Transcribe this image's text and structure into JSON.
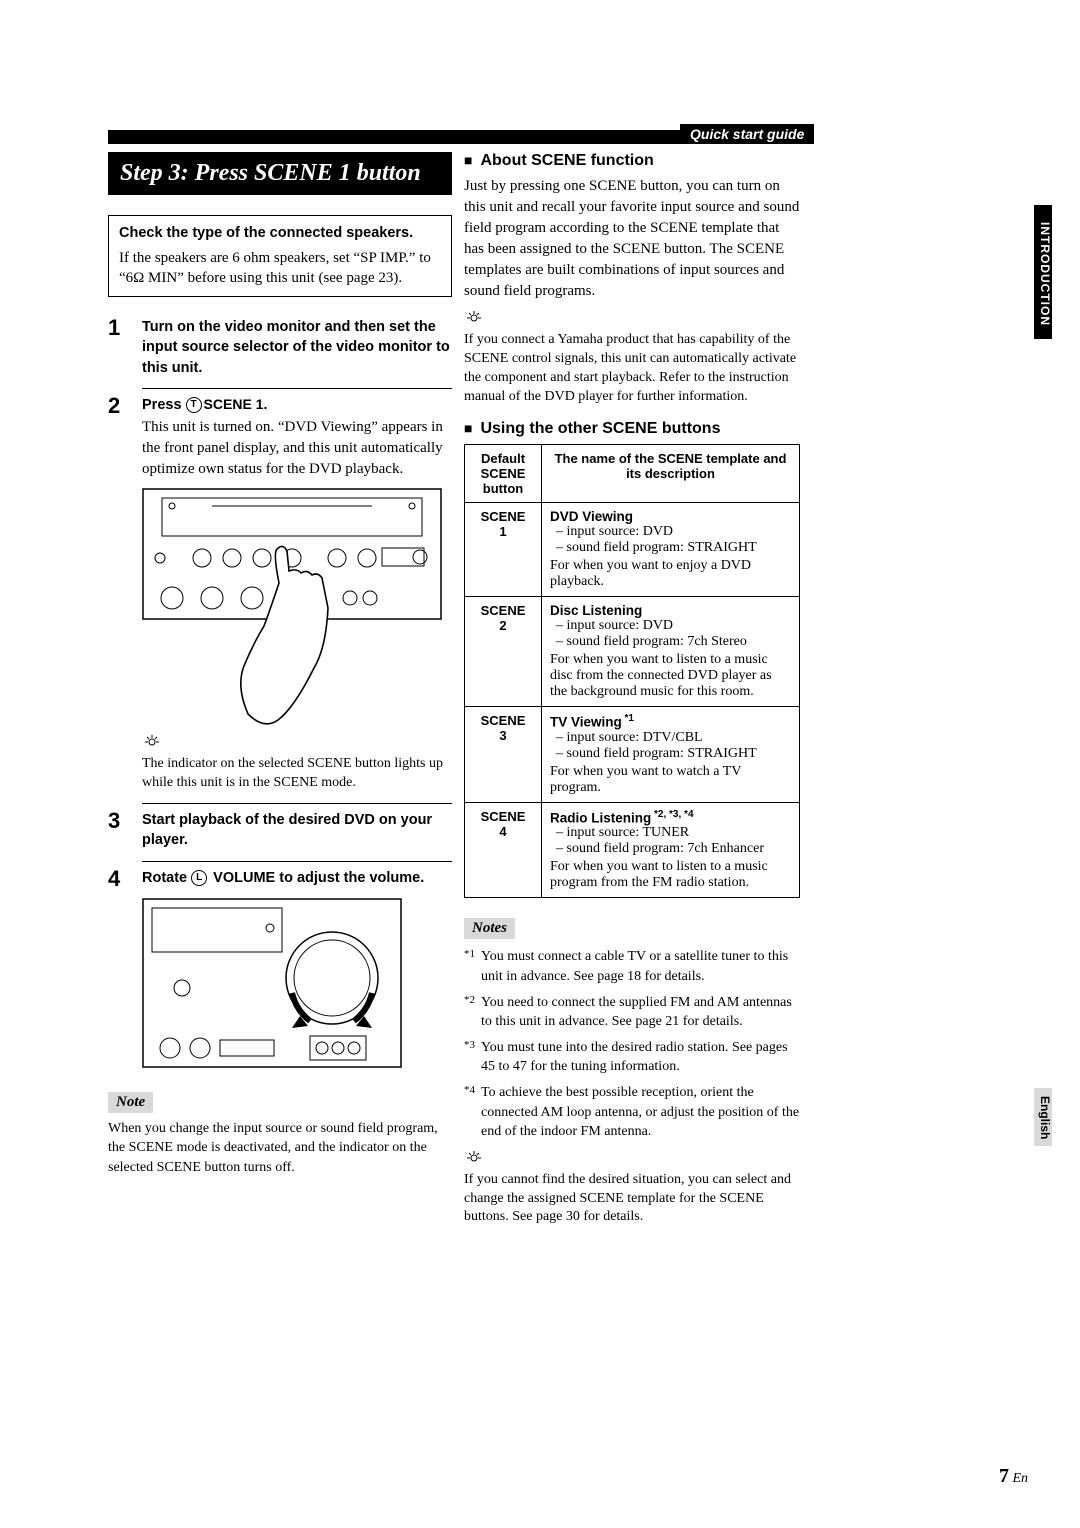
{
  "meta": {
    "guide_label": "Quick start guide",
    "side_tab": "INTRODUCTION",
    "lang_tab": "English",
    "page_num": "7",
    "page_lang": "En"
  },
  "step_heading": "Step 3: Press SCENE 1 button",
  "checkbox": {
    "title": "Check the type of the connected speakers.",
    "body": "If the speakers are 6 ohm speakers, set “SP IMP.” to “6Ω MIN” before using this unit (see page 23)."
  },
  "steps": [
    {
      "num": "1",
      "head": "Turn on the video monitor and then set the input source selector of the video monitor to this unit."
    },
    {
      "num": "2",
      "head_pre": "Press ",
      "head_circ": "T",
      "head_post": "SCENE 1.",
      "body": "This unit is turned on. “DVD Viewing” appears in the front panel display, and this unit automatically optimize own status for the DVD playback.",
      "tip": "The indicator on the selected SCENE button lights up while this unit is in the SCENE mode."
    },
    {
      "num": "3",
      "head": "Start playback of the desired DVD on your player."
    },
    {
      "num": "4",
      "head_pre": "Rotate ",
      "head_circ": "L",
      "head_post": " VOLUME to adjust the volume."
    }
  ],
  "left_note": {
    "label": "Note",
    "text": "When you change the input source or sound field program, the SCENE mode is deactivated, and the indicator on the selected SCENE button turns off."
  },
  "right": {
    "about": {
      "heading": "About SCENE function",
      "para": "Just by pressing one SCENE button, you can turn on this unit and recall your favorite input source and sound field program according to the SCENE template that has been assigned to the SCENE button. The SCENE templates are built combinations of input sources and sound field programs.",
      "tip": "If you connect a Yamaha product that has capability of the SCENE control signals, this unit can automatically activate the component and start playback. Refer to the instruction manual of the DVD player for further information."
    },
    "using": {
      "heading": "Using the other SCENE buttons",
      "table": {
        "h1": "Default SCENE button",
        "h2": "The name of the SCENE template and its description",
        "rows": [
          {
            "btn": "SCENE 1",
            "name": "DVD Viewing",
            "name_sup": "",
            "lines": [
              "– input source: DVD",
              "– sound field program: STRAIGHT"
            ],
            "for": "For when you want to enjoy a DVD playback."
          },
          {
            "btn": "SCENE 2",
            "name": "Disc Listening",
            "name_sup": "",
            "lines": [
              "– input source: DVD",
              "– sound field program: 7ch Stereo"
            ],
            "for": "For when you want to listen to a music disc from the connected DVD player as the background music for this room."
          },
          {
            "btn": "SCENE 3",
            "name": "TV Viewing",
            "name_sup": " *1",
            "lines": [
              "– input source: DTV/CBL",
              "– sound field program: STRAIGHT"
            ],
            "for": "For when you want to watch a TV program."
          },
          {
            "btn": "SCENE 4",
            "name": "Radio Listening",
            "name_sup": " *2, *3, *4",
            "lines": [
              "– input source: TUNER",
              "– sound field program: 7ch Enhancer"
            ],
            "for": "For when you want to listen to a music program from the FM radio station."
          }
        ]
      }
    },
    "notes": {
      "label": "Notes",
      "items": [
        {
          "mk": "*1",
          "text": "You must connect a cable TV or a satellite tuner to this unit in advance. See page 18 for details."
        },
        {
          "mk": "*2",
          "text": "You need to connect the supplied FM and AM antennas to this unit in advance. See page 21 for details."
        },
        {
          "mk": "*3",
          "text": "You must tune into the desired radio station. See pages 45 to 47 for the tuning information."
        },
        {
          "mk": "*4",
          "text": "To achieve the best possible reception, orient the connected AM loop antenna, or adjust the position of the end of the indoor FM antenna."
        }
      ],
      "final_tip": "If you cannot find the desired situation, you can select and change the assigned SCENE template for the SCENE buttons. See page 30 for details."
    }
  }
}
